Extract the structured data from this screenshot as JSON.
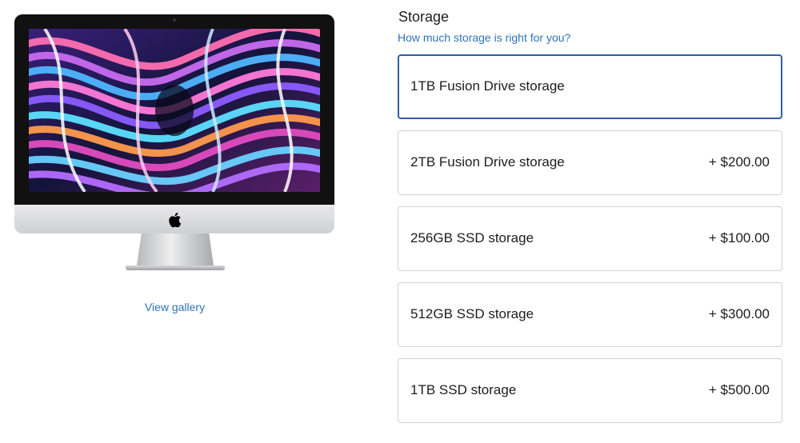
{
  "product": {
    "view_gallery": "View gallery",
    "apple_logo_icon": "apple-logo-icon"
  },
  "storage": {
    "title": "Storage",
    "help_link": "How much storage is right for you?",
    "options": [
      {
        "name": "1TB Fusion Drive storage",
        "price": "",
        "selected": true
      },
      {
        "name": "2TB Fusion Drive storage",
        "price": "+ $200.00",
        "selected": false
      },
      {
        "name": "256GB SSD storage",
        "price": "+ $100.00",
        "selected": false
      },
      {
        "name": "512GB SSD storage",
        "price": "+ $300.00",
        "selected": false
      },
      {
        "name": "1TB SSD storage",
        "price": "+ $500.00",
        "selected": false
      }
    ]
  },
  "colors": {
    "link": "#2f73b6",
    "selected_border": "#2f5fa8",
    "border": "#d2d2d7",
    "text": "#1d1d1f"
  }
}
